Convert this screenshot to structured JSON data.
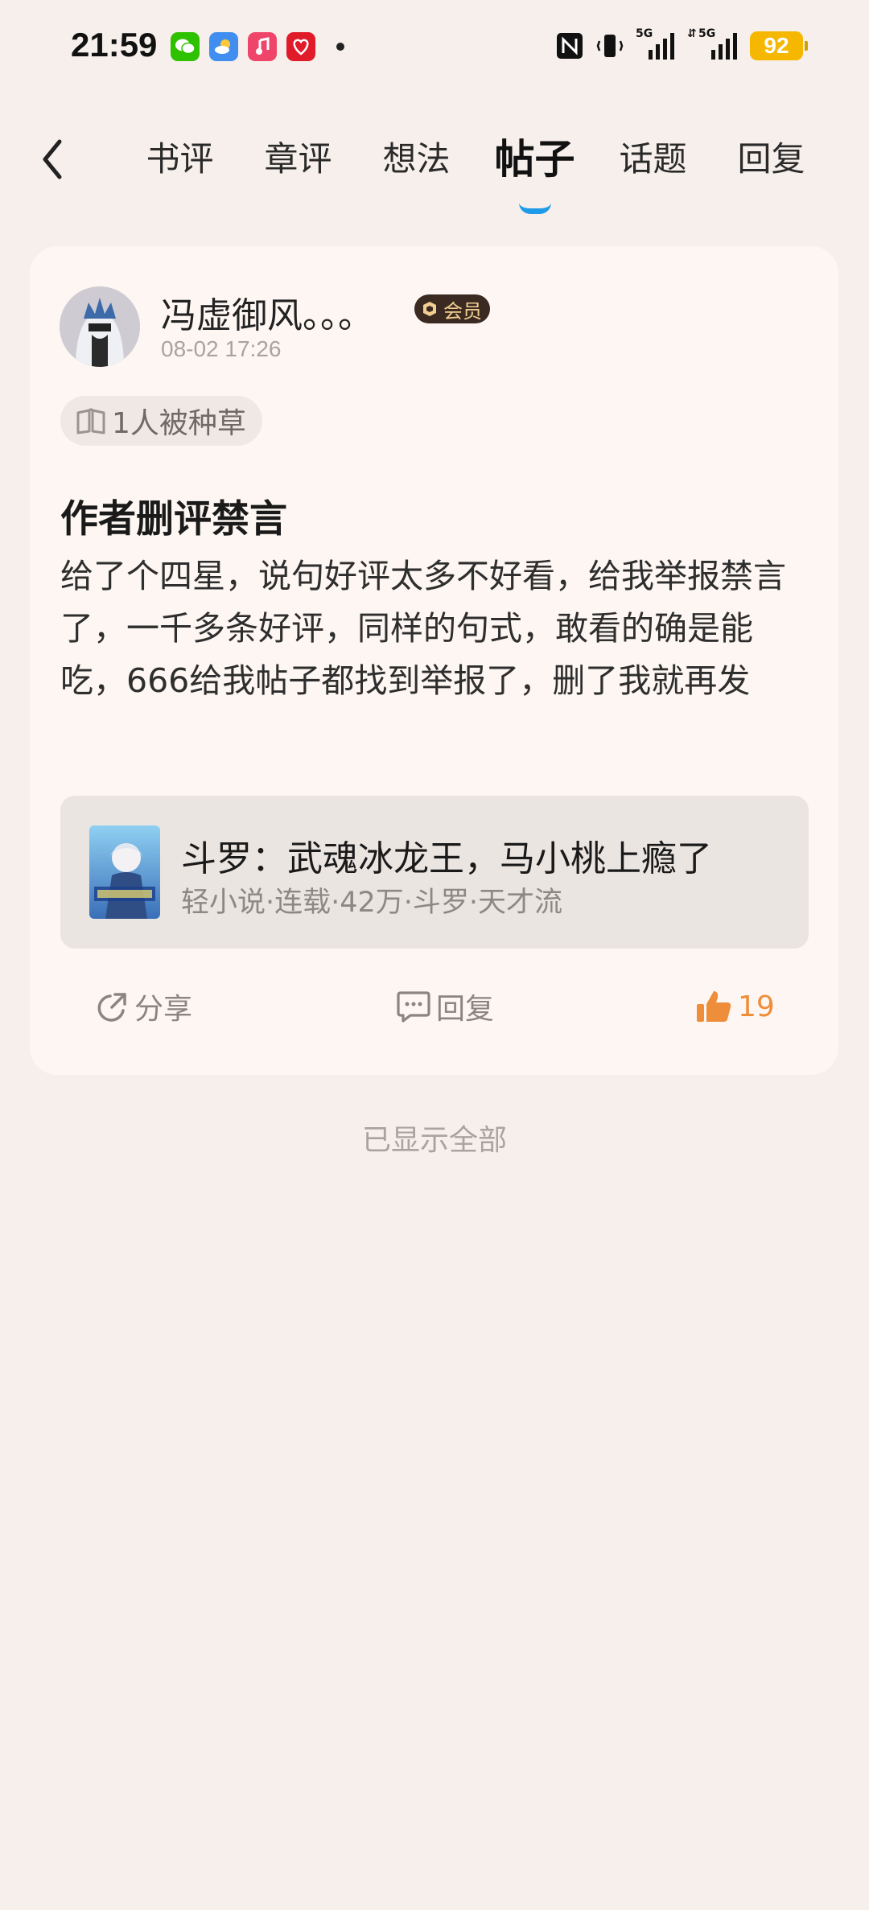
{
  "status_bar": {
    "time": "21:59",
    "battery": "92",
    "network_1": "5G",
    "network_2": "5G"
  },
  "nav": {
    "tabs": [
      {
        "label": "书评",
        "active": false
      },
      {
        "label": "章评",
        "active": false
      },
      {
        "label": "想法",
        "active": false
      },
      {
        "label": "帖子",
        "active": true
      },
      {
        "label": "话题",
        "active": false
      },
      {
        "label": "回复",
        "active": false
      }
    ],
    "accent_color": "#1e9be8"
  },
  "post": {
    "username": "冯虚御风。。。",
    "vip_label": "会员",
    "time": "08-02 17:26",
    "seed_chip": "1人被种草",
    "title": "作者删评禁言",
    "body": "给了个四星，说句好评太多不好看，给我举报禁言了，一千多条好评，同样的句式，敢看的确是能吃，666给我帖子都找到举报了，删了我就再发",
    "book": {
      "title": "斗罗：武魂冰龙王，马小桃上瘾了",
      "meta": "轻小说·连载·42万·斗罗·天才流"
    },
    "actions": {
      "share": "分享",
      "reply": "回复",
      "like_count": "19"
    },
    "like_color": "#ef8e3a"
  },
  "footer": {
    "end_note": "已显示全部"
  }
}
